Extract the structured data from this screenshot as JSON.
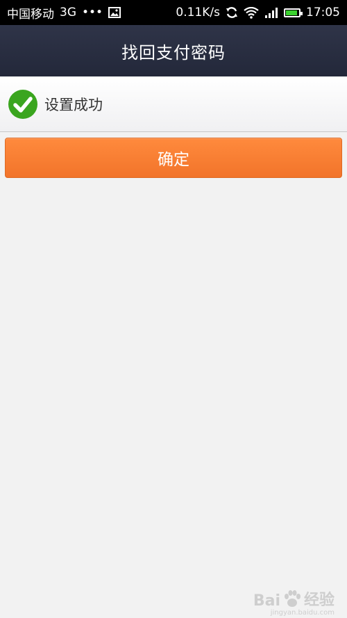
{
  "status_bar": {
    "carrier": "中国移动",
    "network": "3G",
    "dots": "•••",
    "speed": "0.11K/s",
    "time": "17:05",
    "battery_level": 0.9,
    "battery_color": "#3bd12f"
  },
  "header": {
    "title": "找回支付密码",
    "background": "#2a2f42"
  },
  "result": {
    "icon": "check-circle-icon",
    "icon_color": "#3aa51f",
    "message": "设置成功"
  },
  "actions": {
    "confirm_label": "确定",
    "confirm_color": "#f57d30"
  },
  "watermark": {
    "brand_left": "Bai",
    "brand_right": "经验",
    "domain": "jingyan.baidu.com"
  }
}
